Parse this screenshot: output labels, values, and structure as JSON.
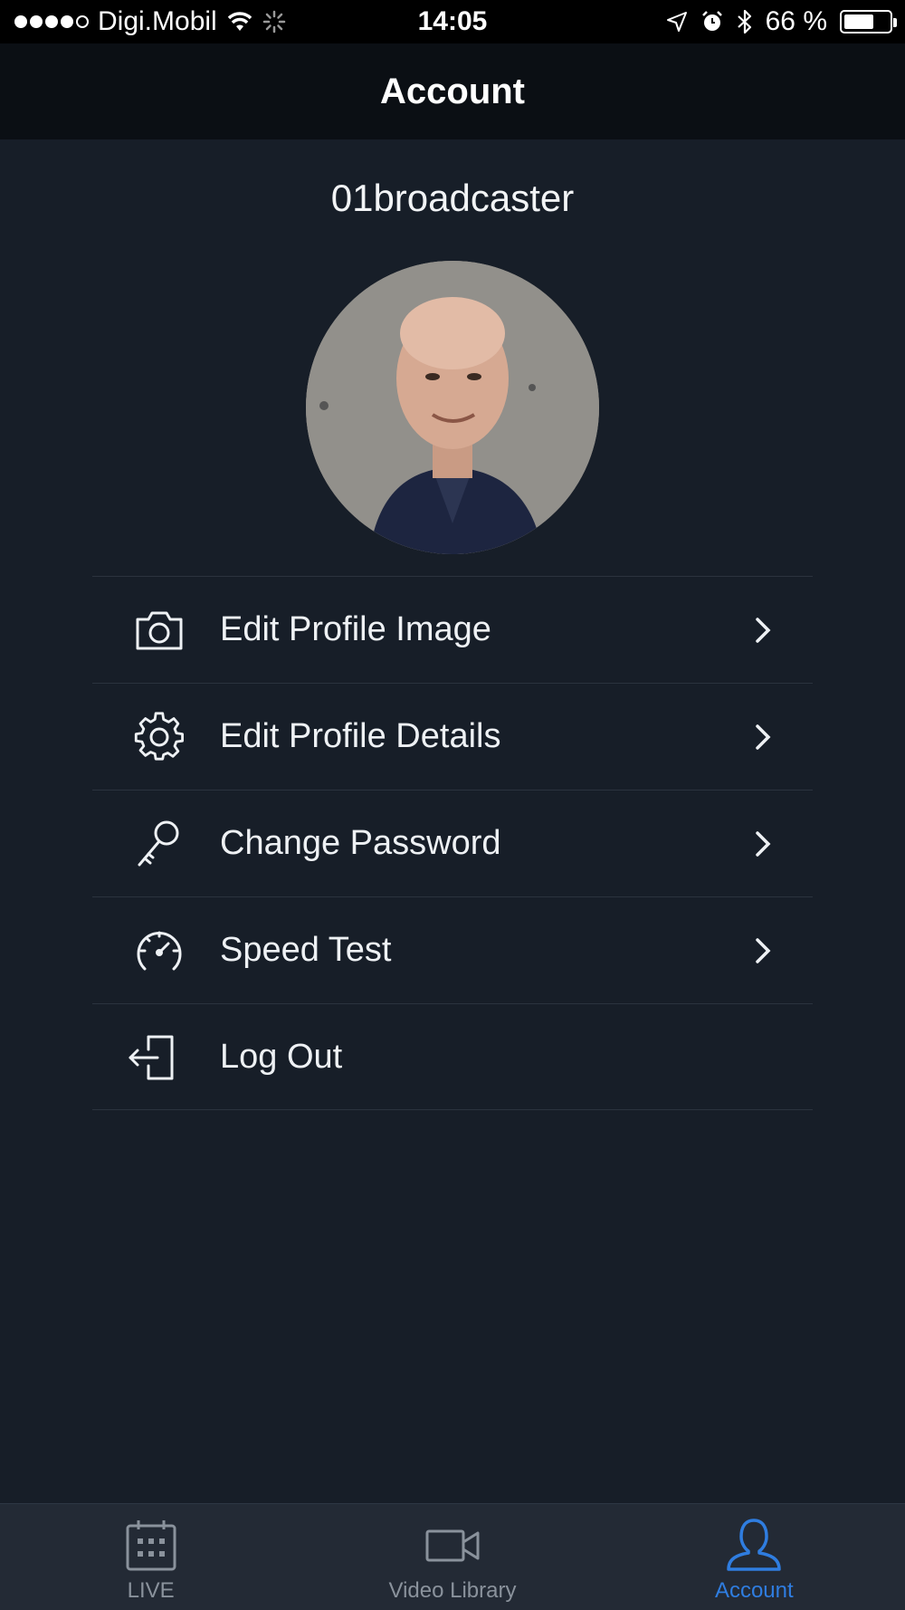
{
  "status_bar": {
    "carrier": "Digi.Mobil",
    "time": "14:05",
    "battery": "66 %",
    "battery_level": 0.66
  },
  "nav": {
    "title": "Account"
  },
  "profile": {
    "username": "01broadcaster"
  },
  "menu": {
    "items": [
      {
        "label": "Edit Profile Image",
        "icon": "camera-icon",
        "has_chevron": true
      },
      {
        "label": "Edit Profile Details",
        "icon": "gear-icon",
        "has_chevron": true
      },
      {
        "label": "Change Password",
        "icon": "key-icon",
        "has_chevron": true
      },
      {
        "label": "Speed Test",
        "icon": "speedometer-icon",
        "has_chevron": true
      },
      {
        "label": "Log Out",
        "icon": "logout-icon",
        "has_chevron": false
      }
    ]
  },
  "tabs": [
    {
      "label": "LIVE",
      "icon": "calendar-icon",
      "active": false
    },
    {
      "label": "Video Library",
      "icon": "video-camera-icon",
      "active": false
    },
    {
      "label": "Account",
      "icon": "user-icon",
      "active": true
    }
  ],
  "colors": {
    "background": "#171e28",
    "nav_background": "#0b0f14",
    "tab_bar_background": "#232a35",
    "accent": "#2f7de0",
    "inactive_tab": "#8a929c"
  }
}
